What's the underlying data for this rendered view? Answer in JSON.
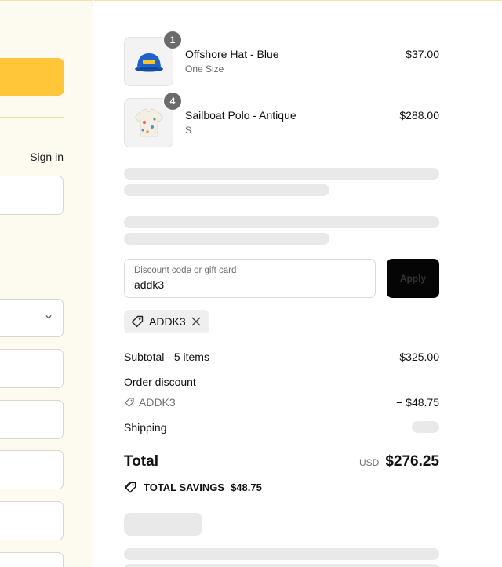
{
  "left": {
    "sign_in_label": "Sign in"
  },
  "cart": {
    "items": [
      {
        "name": "Offshore Hat - Blue",
        "variant": "One Size",
        "price": "$37.00",
        "quantity": "1",
        "thumbnail_icon": "hat-icon"
      },
      {
        "name": "Sailboat Polo - Antique",
        "variant": "S",
        "price": "$288.00",
        "quantity": "4",
        "thumbnail_icon": "polo-shirt-icon"
      }
    ]
  },
  "discount": {
    "placeholder": "Discount code or gift card",
    "value": "addk3",
    "apply_label": "Apply",
    "applied_code": "ADDK3"
  },
  "summary": {
    "subtotal_label": "Subtotal · 5 items",
    "subtotal_value": "$325.00",
    "order_discount_label": "Order discount",
    "discount_code": "ADDK3",
    "discount_value": "− $48.75",
    "shipping_label": "Shipping",
    "total_label": "Total",
    "currency": "USD",
    "total_value": "$276.25",
    "savings_label": "TOTAL SAVINGS",
    "savings_value": "$48.75"
  },
  "colors": {
    "accent": "#ffc63a",
    "left_bg": "#fdfbef",
    "apply_bg": "#050505"
  }
}
